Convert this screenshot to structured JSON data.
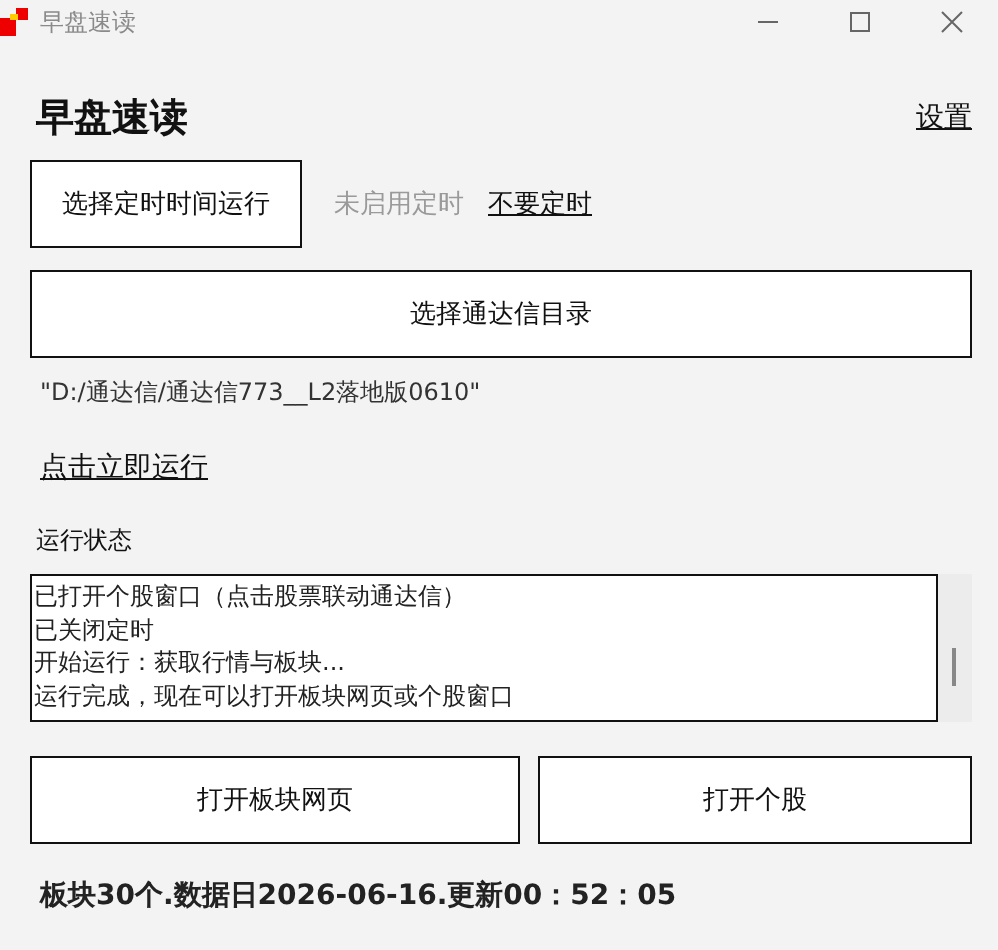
{
  "window": {
    "title": "早盘速读"
  },
  "header": {
    "title": "早盘速读",
    "settings_link": "设置"
  },
  "timer": {
    "button": "选择定时时间运行",
    "status": "未启用定时",
    "disable_link": "不要定时"
  },
  "directory": {
    "button": "选择通达信目录",
    "path": "\"D:/通达信/通达信773__L2落地版0610\""
  },
  "run_link": "点击立即运行",
  "log": {
    "label": "运行状态",
    "lines": [
      "已打开个股窗口（点击股票联动通达信）",
      "已关闭定时",
      "开始运行：获取行情与板块...",
      "运行完成，现在可以打开板块网页或个股窗口"
    ]
  },
  "buttons": [
    "打开板块网页",
    "打开个股"
  ],
  "footer": "板块30个.数据日2026-06-16.更新00：52：05"
}
